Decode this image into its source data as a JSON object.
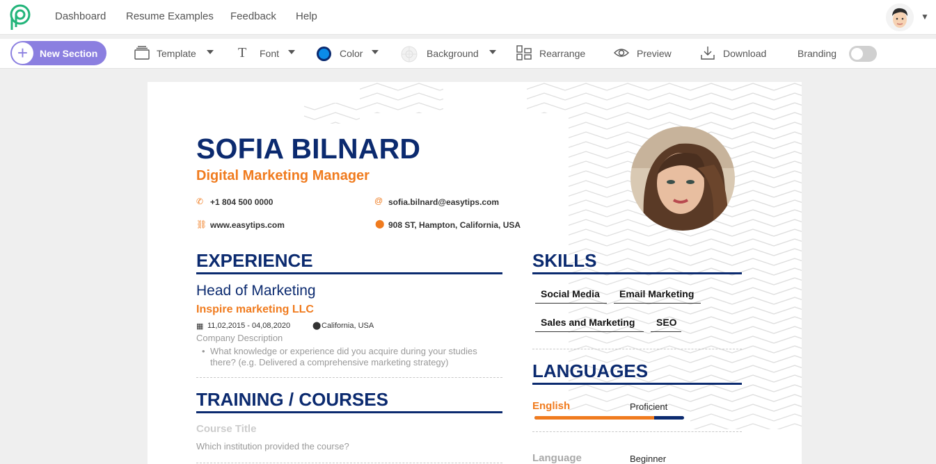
{
  "nav": {
    "links": [
      "Dashboard",
      "Resume Examples",
      "Feedback",
      "Help"
    ]
  },
  "toolbar": {
    "new_section": "New Section",
    "template": "Template",
    "font": "Font",
    "color": "Color",
    "background": "Background",
    "rearrange": "Rearrange",
    "preview": "Preview",
    "download": "Download",
    "branding": "Branding",
    "branding_enabled": false,
    "accent_color": "#0b8be8"
  },
  "resume": {
    "name": "SOFIA BILNARD",
    "role": "Digital Marketing Manager",
    "phone": "+1 804 500 0000",
    "email": "sofia.bilnard@easytips.com",
    "website": "www.easytips.com",
    "address": "908 ST, Hampton, California, USA",
    "experience": {
      "title": "EXPERIENCE",
      "job_title": "Head of Marketing",
      "company": "Inspire marketing LLC",
      "dates": "11,02,2015 - 04,08,2020",
      "location": "California, USA",
      "description": "Company Description",
      "bullet_line1": "What knowledge or experience did you acquire during your studies",
      "bullet_line2": "there? (e.g. Delivered a comprehensive marketing strategy)"
    },
    "training": {
      "title": "TRAINING / COURSES",
      "course_title": "Course Title",
      "institution": "Which institution provided the course?"
    },
    "skills": {
      "title": "SKILLS",
      "items": [
        "Social Media",
        "Email Marketing",
        "Sales and Marketing",
        "SEO"
      ]
    },
    "languages": {
      "title": "LANGUAGES",
      "items": [
        {
          "name": "English",
          "level": "Proficient",
          "progress": 0.8
        },
        {
          "name": "Language",
          "level": "Beginner"
        }
      ]
    },
    "colors": {
      "primary": "#0b2a6f",
      "accent": "#f07b1e"
    }
  }
}
